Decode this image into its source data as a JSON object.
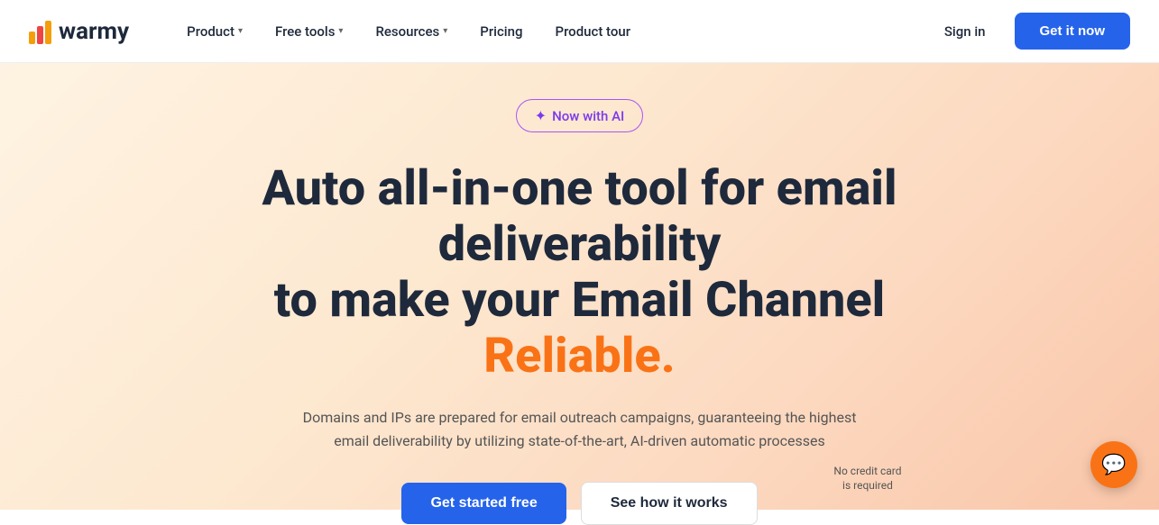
{
  "logo": {
    "text": "warmy"
  },
  "navbar": {
    "product_label": "Product",
    "free_tools_label": "Free tools",
    "resources_label": "Resources",
    "pricing_label": "Pricing",
    "product_tour_label": "Product tour",
    "sign_in_label": "Sign in",
    "get_it_now_label": "Get it now"
  },
  "hero": {
    "ai_badge_label": "Now with AI",
    "headline_line1": "Auto all-in-one tool for email deliverability",
    "headline_line2_prefix": "to make your Email Channel ",
    "headline_line2_accent": "Reliable.",
    "subtext": "Domains and IPs are prepared for email outreach campaigns, guaranteeing the highest email deliverability by utilizing state-of-the-art, AI-driven automatic processes",
    "cta_primary_label": "Get started free",
    "cta_secondary_label": "See how it works",
    "no_credit_card_line1": "No credit card",
    "no_credit_card_line2": "is required"
  },
  "chat": {
    "icon": "💬"
  }
}
